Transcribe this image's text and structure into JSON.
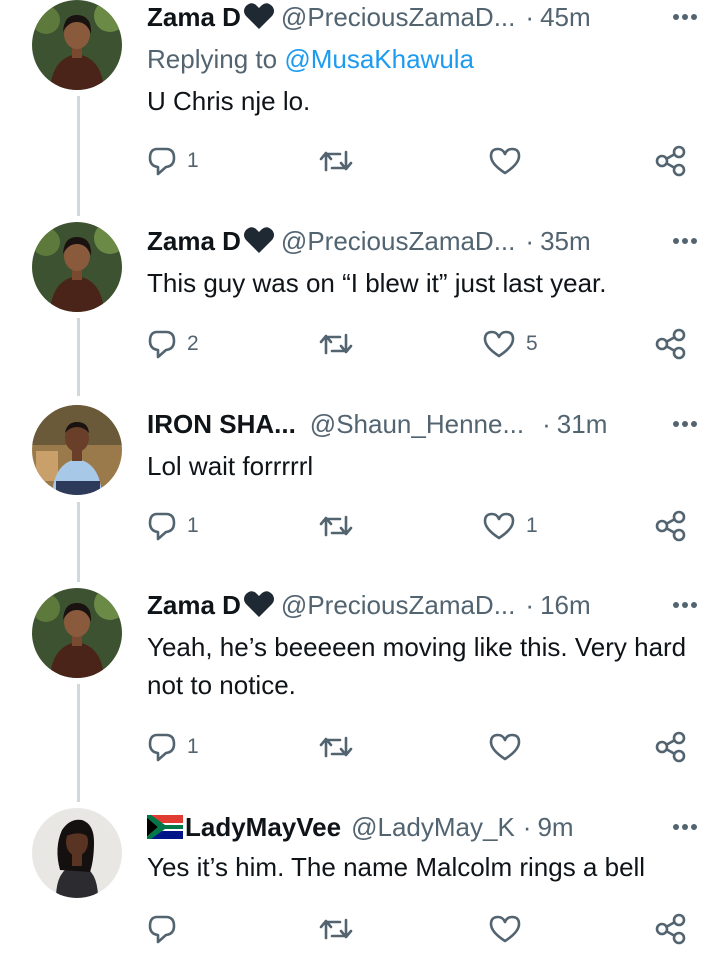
{
  "tweets": [
    {
      "name": "Zama D",
      "handle": "@PreciousZamaD...",
      "sep": "·",
      "time": "45m",
      "replying_prefix": "Replying to ",
      "replying_to": "@MusaKhawula",
      "text": "U Chris nje lo.",
      "reply_count": "1",
      "retweet_count": "",
      "like_count": ""
    },
    {
      "name": "Zama D",
      "handle": "@PreciousZamaD...",
      "sep": "·",
      "time": "35m",
      "text": "This guy was on “I blew it” just last year.",
      "reply_count": "2",
      "retweet_count": "",
      "like_count": "5"
    },
    {
      "name": "IRON SHA...",
      "handle": "@Shaun_Henne...",
      "sep": "·",
      "time": "31m",
      "text": "Lol wait forrrrrl",
      "reply_count": "1",
      "retweet_count": "",
      "like_count": "1"
    },
    {
      "name": "Zama D",
      "handle": "@PreciousZamaD...",
      "sep": "·",
      "time": "16m",
      "text": "Yeah, he’s beeeeen moving like this. Very hard not to notice.",
      "reply_count": "1",
      "retweet_count": "",
      "like_count": ""
    },
    {
      "name": "LadyMayVee",
      "handle": "@LadyMay_K",
      "sep": "·",
      "time": "9m",
      "text": "Yes it’s him. The name Malcolm rings a bell",
      "reply_count": "",
      "retweet_count": "",
      "like_count": ""
    }
  ],
  "icons": {
    "reply": "reply-icon",
    "retweet": "retweet-icon",
    "like": "heart-icon",
    "share": "share-icon",
    "more": "more-icon",
    "name_badge": "black-heart-icon",
    "flag": "south-africa-flag-icon"
  },
  "colors": {
    "text": "#0f1419",
    "secondary": "#536471",
    "link": "#1d9bf0",
    "thread_line": "#cfd9de"
  }
}
